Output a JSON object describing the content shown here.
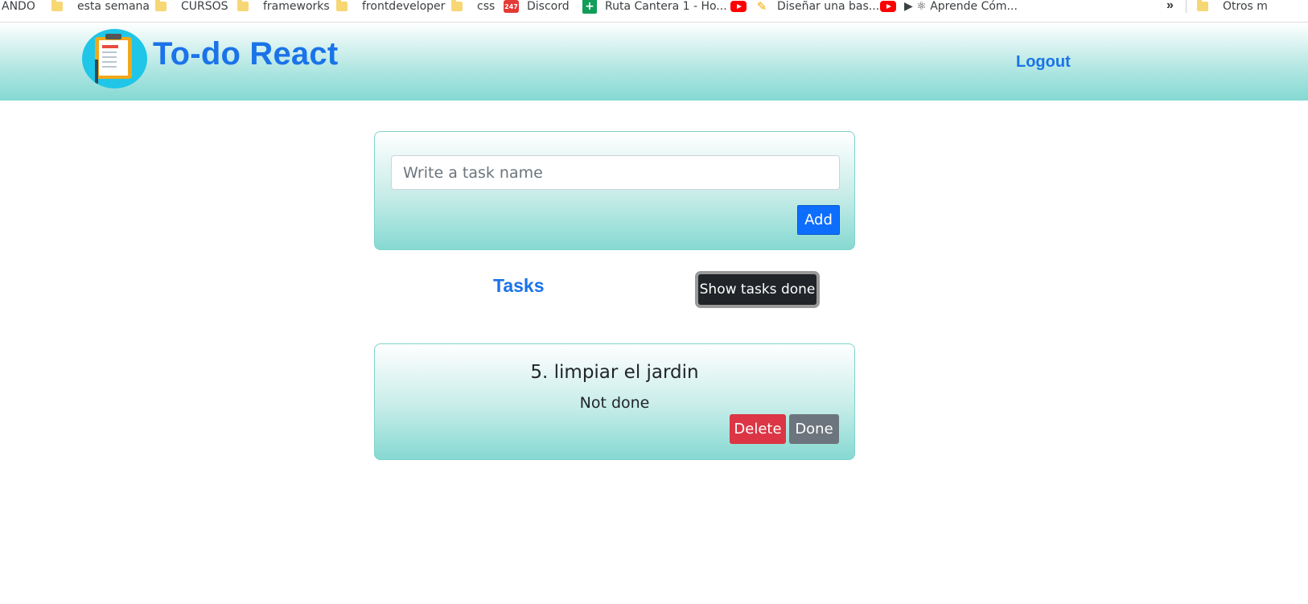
{
  "bookmarks": [
    {
      "label": "ANDO",
      "icon": "none"
    },
    {
      "label": "esta semana",
      "icon": "folder-icon"
    },
    {
      "label": "CURSOS",
      "icon": "folder-icon"
    },
    {
      "label": "frameworks",
      "icon": "folder-icon"
    },
    {
      "label": "frontdeveloper",
      "icon": "folder-icon"
    },
    {
      "label": "css",
      "icon": "folder-icon"
    },
    {
      "label": "Discord",
      "icon": "calendar-247-icon",
      "icon_text": "247"
    },
    {
      "label": "Ruta Cantera 1 - Ho...",
      "icon": "sheets-icon",
      "icon_text": "+"
    },
    {
      "label": "Diseñar una bas...",
      "icon": "youtube-icon"
    },
    {
      "label": "▶ ⚛ Aprende Cóm...",
      "icon": "youtube-icon"
    },
    {
      "label": "Otros m",
      "icon": "folder-icon"
    }
  ],
  "bookmarks_overflow": "»",
  "navbar": {
    "brand": "To-do React",
    "logout": "Logout",
    "logo_icon": "clipboard-icon"
  },
  "add_form": {
    "placeholder": "Write a task name",
    "value": "",
    "add_label": "Add"
  },
  "tasks_section": {
    "title": "Tasks",
    "toggle_label": "Show tasks done"
  },
  "tasks": [
    {
      "name": "5. limpiar el jardin",
      "status": "Not done",
      "delete_label": "Delete",
      "done_label": "Done"
    }
  ],
  "colors": {
    "brand": "#1a73e8",
    "primary_button": "#0d6efd",
    "danger_button": "#dc3545",
    "secondary_button": "#6c757d",
    "dark_button": "#212529",
    "card_gradient_end": "#86d9d2"
  }
}
